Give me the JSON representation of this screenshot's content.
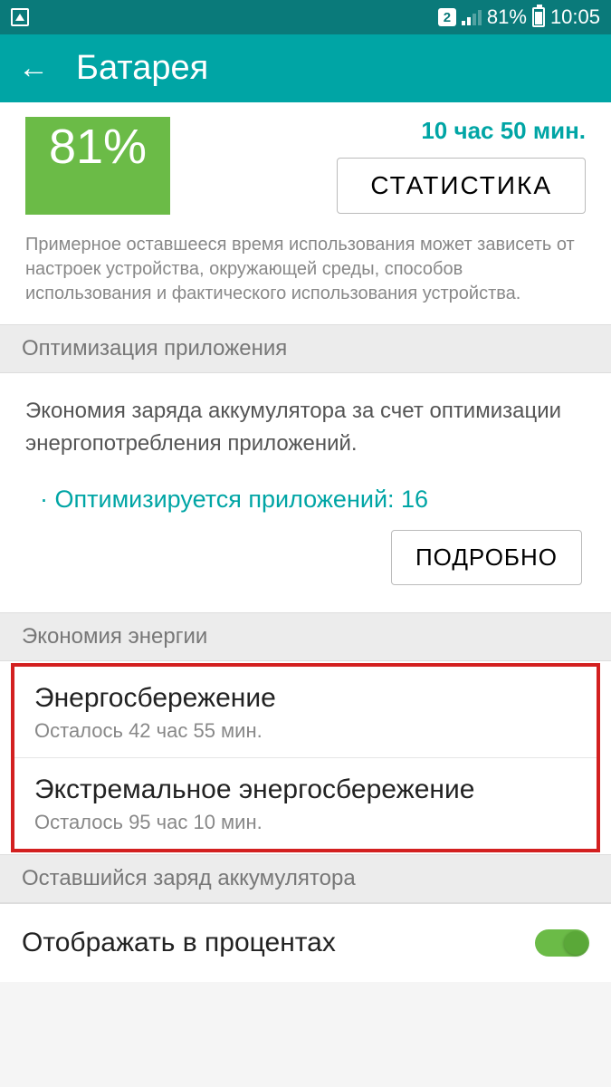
{
  "status": {
    "sim": "2",
    "battery_pct": "81%",
    "time": "10:05"
  },
  "header": {
    "title": "Батарея"
  },
  "battery": {
    "percent_display": "81%",
    "remaining_top": "10 час 50 мин.",
    "stat_button": "СТАТИСТИКА",
    "note": "Примерное оставшееся время использования может зависеть от настроек устройства, окружающей среды, способов использования и фактического использования устройства."
  },
  "sections": {
    "optimization": {
      "header": "Оптимизация приложения",
      "description": "Экономия заряда аккумулятора за счет оптимизации энергопотребления приложений.",
      "count_line": "· Оптимизируется приложений: 16",
      "detail_button": "ПОДРОБНО"
    },
    "power_saving": {
      "header": "Экономия энергии",
      "items": [
        {
          "title": "Энергосбережение",
          "sub": "Осталось 42 час 55 мин."
        },
        {
          "title": "Экстремальное энергосбережение",
          "sub": "Осталось 95 час 10 мин."
        }
      ]
    },
    "remaining_charge": {
      "header": "Оставшийся заряд аккумулятора"
    },
    "percent_toggle": {
      "label": "Отображать в процентах",
      "on": true
    }
  }
}
